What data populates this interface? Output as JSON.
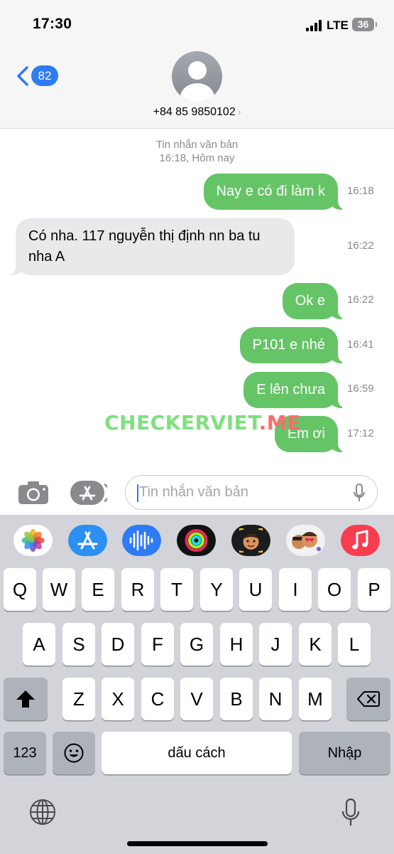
{
  "status_bar": {
    "time": "17:30",
    "network": "LTE",
    "battery": "36"
  },
  "header": {
    "back_count": "82",
    "contact": "+84 85 9850102",
    "contact_chevron": "›"
  },
  "thread": {
    "meta_line1": "Tin nhắn văn bản",
    "meta_line2": "16:18, Hôm nay",
    "messages": [
      {
        "direction": "sent",
        "text": "Nay e có đi làm k",
        "time": "16:18"
      },
      {
        "direction": "received",
        "text": "Có nha. 117 nguyễn thị định nn ba tu nha A",
        "time": "16:22"
      },
      {
        "direction": "sent",
        "text": "Ok e",
        "time": "16:22"
      },
      {
        "direction": "sent",
        "text": "P101 e nhé",
        "time": "16:41"
      },
      {
        "direction": "sent",
        "text": "E lên chưa",
        "time": "16:59"
      },
      {
        "direction": "sent",
        "text": "Em ơi",
        "time": "17:12"
      }
    ],
    "watermark_a": "CHECKERVIET",
    "watermark_b": ".ME"
  },
  "input": {
    "placeholder": "Tin nhắn văn bản"
  },
  "keyboard": {
    "apps": [
      "photos-app",
      "app-store-app",
      "audio-message-app",
      "activity-app",
      "memoji-app",
      "animoji-stickers-app",
      "music-app"
    ],
    "row1": [
      "Q",
      "W",
      "E",
      "R",
      "T",
      "Y",
      "U",
      "I",
      "O",
      "P"
    ],
    "row2": [
      "A",
      "S",
      "D",
      "F",
      "G",
      "H",
      "J",
      "K",
      "L"
    ],
    "row3": [
      "Z",
      "X",
      "C",
      "V",
      "B",
      "N",
      "M"
    ],
    "numbers_key": "123",
    "space_key": "dấu cách",
    "return_key": "Nhập"
  },
  "colors": {
    "sent_bubble": "#65c466",
    "received_bubble": "#e9e9eb",
    "accent": "#2f7bf5"
  }
}
